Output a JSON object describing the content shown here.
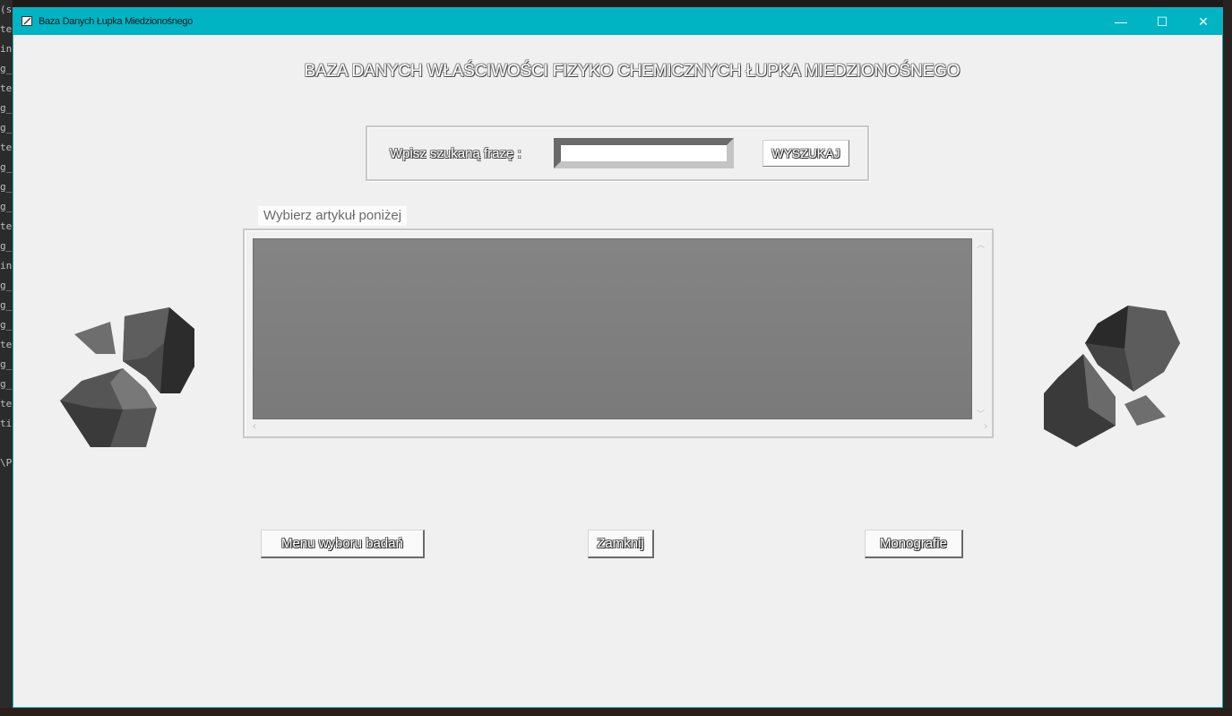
{
  "window": {
    "title": "Baza Danych Łupka Miedzionośnego",
    "controls": {
      "minimize": "—",
      "maximize": "☐",
      "close": "✕"
    },
    "accent": "#00b4c4"
  },
  "heading": "BAZA DANYCH WŁAŚCIWOŚCI FIZYKO CHEMICZNYCH ŁUPKA MIEDZIONOŚNEGO",
  "search": {
    "label": "Wpisz szukaną frazę :",
    "value": "",
    "button": "WYSZUKAJ"
  },
  "list": {
    "caption": "Wybierz artykuł poniżej",
    "items": []
  },
  "buttons": {
    "menu": "Menu wyboru badań",
    "close": "Zamknij",
    "monographs": "Monografie"
  },
  "background": {
    "editor_lines": [
      "(s)",
      "te",
      "in",
      "g_",
      "te",
      "g_",
      "g_",
      "te",
      "g_",
      "g_",
      "g_",
      "te",
      "g_",
      "in",
      "g_",
      "g_",
      "g_",
      "te",
      "g_",
      "g_",
      "te",
      "tic",
      "",
      "\\P"
    ]
  }
}
